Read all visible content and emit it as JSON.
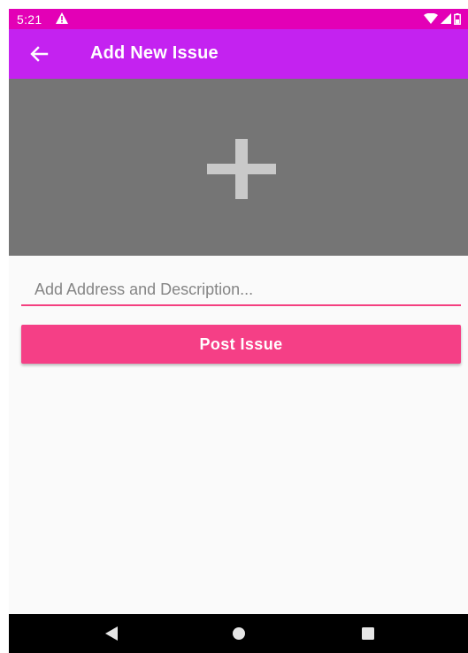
{
  "status_bar": {
    "time": "5:21",
    "icons": [
      "warning-icon",
      "wifi-icon",
      "signal-icon",
      "battery-icon"
    ],
    "background": "#e300b6"
  },
  "app_bar": {
    "title": "Add New Issue",
    "back_icon": "arrow-left-icon",
    "background": "#c422f0"
  },
  "image_picker": {
    "icon": "plus-icon",
    "background": "#757575"
  },
  "form": {
    "description_placeholder": "Add Address and Description...",
    "description_value": "",
    "post_label": "Post Issue",
    "accent": "#f53f86"
  },
  "nav_bar": {
    "buttons": [
      "back-triangle-icon",
      "home-circle-icon",
      "recents-square-icon"
    ]
  }
}
